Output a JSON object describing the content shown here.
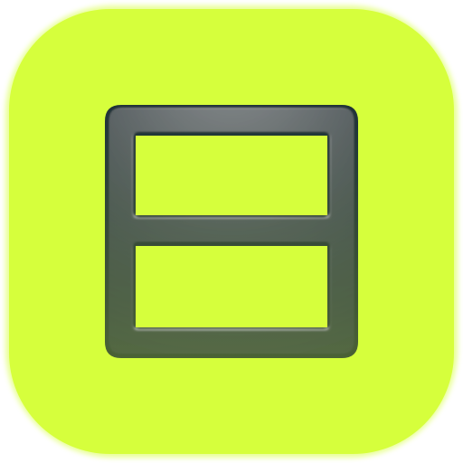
{
  "icon": {
    "name": "split-window-icon",
    "background_color": "#d6ff3c",
    "glyph_color_top": "#1f3238",
    "glyph_color_bottom": "#4b6236"
  }
}
